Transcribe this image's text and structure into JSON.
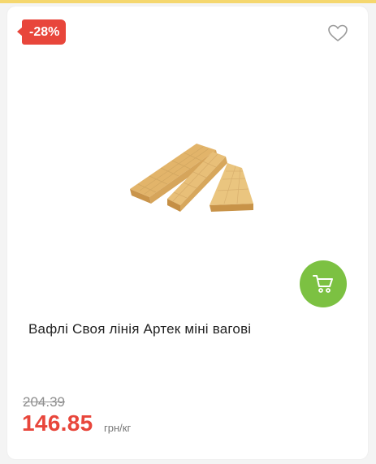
{
  "product": {
    "discount_badge": "-28%",
    "title": "Вафлі Своя лінія Артек міні вагові",
    "old_price": "204.39",
    "new_price": "146.85",
    "unit": "грн/кг"
  },
  "icons": {
    "favorite": "heart-outline-icon",
    "cart": "shopping-cart-icon"
  },
  "colors": {
    "accent_red": "#e8463b",
    "cart_green": "#7cc142",
    "top_strip": "#f5d76e"
  }
}
